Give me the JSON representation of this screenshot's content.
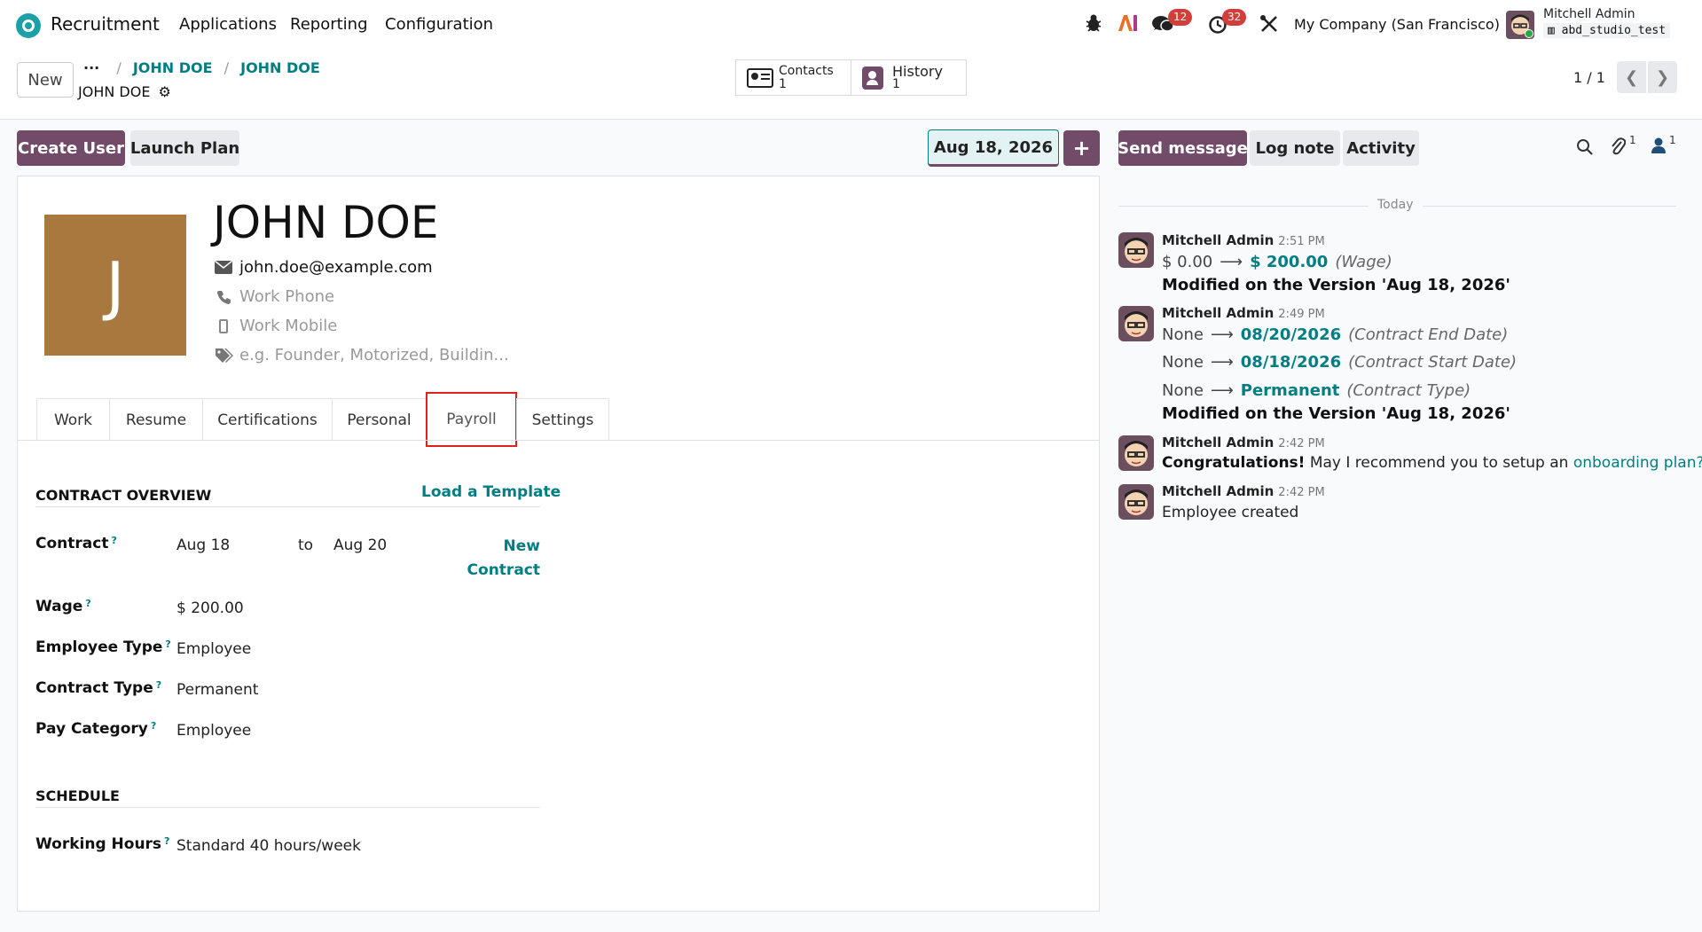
{
  "nav": {
    "app_name": "Recruitment",
    "menu": [
      "Applications",
      "Reporting",
      "Configuration"
    ],
    "messages_count": "12",
    "activities_count": "32",
    "company": "My Company (San Francisco)",
    "user_name": "Mitchell Admin",
    "db_name": "abd_studio_test"
  },
  "cp": {
    "new_label": "New",
    "breadcrumb": [
      "JOHN DOE",
      "JOHN DOE"
    ],
    "record_name": "JOHN DOE",
    "contacts_label": "Contacts",
    "contacts_count": "1",
    "history_label": "History",
    "history_count": "1",
    "pager": "1 / 1"
  },
  "actions": {
    "create_user": "Create User",
    "launch_plan": "Launch Plan",
    "version_date": "Aug 18, 2026",
    "send_message": "Send message",
    "log_note": "Log note",
    "activity": "Activity",
    "attachments_count": "1",
    "followers_count": "1"
  },
  "employee": {
    "avatar_initial": "J",
    "name": "JOHN DOE",
    "email": "john.doe@example.com",
    "work_phone_placeholder": "Work Phone",
    "work_mobile_placeholder": "Work Mobile",
    "tags_placeholder": "e.g. Founder, Motorized, Buildin..."
  },
  "tabs": [
    "Work",
    "Resume",
    "Certifications",
    "Personal",
    "Payroll",
    "Settings"
  ],
  "payroll": {
    "contract_overview_title": "CONTRACT OVERVIEW",
    "load_template": "Load a Template",
    "contract_label": "Contract",
    "contract_start": "Aug 18",
    "contract_to": "to",
    "contract_end": "Aug 20",
    "new_contract_1": "New",
    "new_contract_2": "Contract",
    "wage_label": "Wage",
    "wage_value": "$ 200.00",
    "employee_type_label": "Employee Type",
    "employee_type_value": "Employee",
    "contract_type_label": "Contract Type",
    "contract_type_value": "Permanent",
    "pay_category_label": "Pay Category",
    "pay_category_value": "Employee",
    "schedule_title": "SCHEDULE",
    "working_hours_label": "Working Hours",
    "working_hours_value": "Standard 40 hours/week",
    "help_mark": "?"
  },
  "chatter": {
    "today": "Today",
    "messages": [
      {
        "author": "Mitchell Admin",
        "time": "2:51 PM",
        "changes": [
          {
            "old": "$ 0.00",
            "new": "$ 200.00",
            "field": "(Wage)"
          }
        ],
        "footer": "Modified on the Version 'Aug 18, 2026'"
      },
      {
        "author": "Mitchell Admin",
        "time": "2:49 PM",
        "changes": [
          {
            "old": "None",
            "new": "08/20/2026",
            "field": "(Contract End Date)"
          },
          {
            "old": "None",
            "new": "08/18/2026",
            "field": "(Contract Start Date)"
          },
          {
            "old": "None",
            "new": "Permanent",
            "field": "(Contract Type)"
          }
        ],
        "footer": "Modified on the Version 'Aug 18, 2026'"
      },
      {
        "author": "Mitchell Admin",
        "time": "2:42 PM",
        "strong": "Congratulations!",
        "text": "May I recommend you to setup an",
        "link": "onboarding plan?"
      },
      {
        "author": "Mitchell Admin",
        "time": "2:42 PM",
        "text": "Employee created"
      }
    ]
  },
  "colors": {
    "primary": "#714b67",
    "link": "#017e84",
    "badge": "#d23f3a",
    "avatar_bg": "#a8783e",
    "highlight": "#e02020"
  }
}
